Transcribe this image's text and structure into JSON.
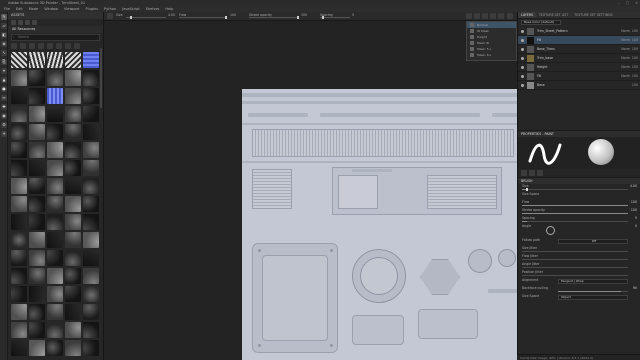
{
  "window": {
    "title": "Adobe Substance 3D Painter - TrimSheet_01"
  },
  "menu": [
    "File",
    "Edit",
    "Mode",
    "Window",
    "Viewport",
    "Plugins",
    "Python",
    "JavaScript",
    "Shelves",
    "Help"
  ],
  "shelf": {
    "header": "ASSETS",
    "category": "All Resources",
    "search_placeholder": "Search",
    "thumbnail_count": 85
  },
  "toolbar": {
    "size_value": "4.00",
    "flow_label": "Flow",
    "flow_value": "100",
    "stroke_opacity_label": "Stroke opacity",
    "stroke_opacity_value": "100",
    "spacing_label": "Spacing",
    "spacing_value": "5"
  },
  "texture_set_popup": {
    "rows": [
      "Normal",
      "ID Mask",
      "Height",
      "Mesh ID",
      "Mask: 5 s",
      "Mask: 6 s"
    ]
  },
  "layers": {
    "tabs": [
      "LAYERS",
      "TEXTURE SET LIST",
      "TEXTURE SET SETTINGS"
    ],
    "channel_dropdown": "Base Color (default)",
    "items": [
      {
        "name": "Trim_Sheet_Pattern",
        "blend": "Norm",
        "opacity": "100"
      },
      {
        "name": "Fill",
        "blend": "Norm",
        "opacity": "100"
      },
      {
        "name": "Base_Trims",
        "blend": "Norm",
        "opacity": "100"
      },
      {
        "name": "Trim_base",
        "blend": "Norm",
        "opacity": "100"
      },
      {
        "name": "Height",
        "blend": "Norm",
        "opacity": "100"
      },
      {
        "name": "Fill",
        "blend": "Norm",
        "opacity": "100"
      },
      {
        "name": "Base",
        "blend": "",
        "opacity": "100"
      }
    ]
  },
  "properties": {
    "header": "PROPERTIES - PAINT",
    "section_brush": "BRUSH",
    "size_label": "Size",
    "size_value": "4.00",
    "size_space_label": "Size Space",
    "flow_label": "Flow",
    "flow_value": "100",
    "stroke_opacity_label": "Stroke opacity",
    "stroke_opacity_value": "100",
    "spacing_label": "Spacing",
    "spacing_value": "5",
    "angle_label": "Angle",
    "angle_value": "0",
    "follow_path_label": "Follow path",
    "follow_path_value": "Off",
    "size_jitter_label": "Size Jitter",
    "flow_jitter_label": "Flow Jitter",
    "angle_jitter_label": "Angle Jitter",
    "position_jitter_label": "Position Jitter",
    "alignment_label": "Alignment",
    "alignment_value": "Tangent | Wrap",
    "backface_label": "Backface culling",
    "backface_value": "90",
    "size_space_dropdown": "Object"
  },
  "status": {
    "text": "Cache Disk Usage: 49% | Version: 8.3.1 (2024.3)"
  },
  "colors": {
    "sheet": "#c4c8d4",
    "accent": "#3e5468"
  }
}
